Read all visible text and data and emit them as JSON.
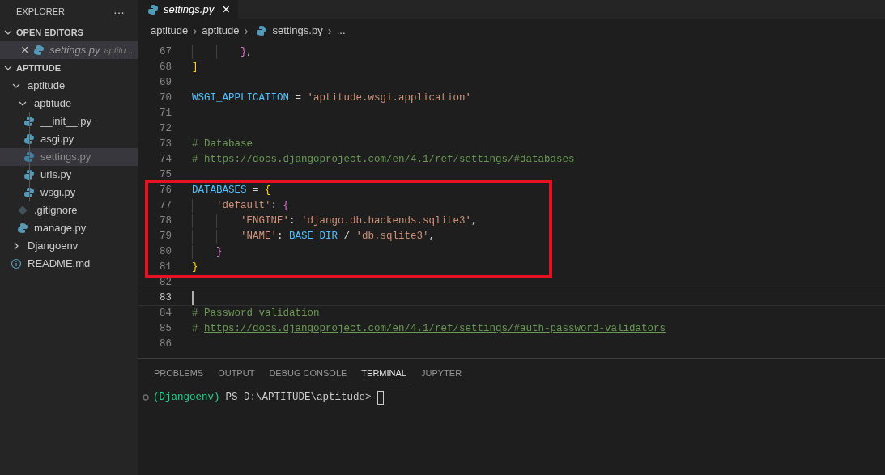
{
  "sidebar": {
    "title": "EXPLORER",
    "more": "···",
    "open_editors": {
      "label": "OPEN EDITORS",
      "expanded": true,
      "items": [
        {
          "close": "×",
          "kind": "python",
          "name": "settings.py",
          "description": "aptitu...",
          "selected": true
        }
      ]
    },
    "folder": {
      "label": "APTITUDE",
      "expanded": true,
      "tree": [
        {
          "kind": "folder",
          "name": "aptitude",
          "expanded": true,
          "selected": false,
          "children": [
            {
              "kind": "folder",
              "name": "aptitude",
              "expanded": true,
              "selected": false,
              "children": [
                {
                  "kind": "python",
                  "name": "__init__.py",
                  "selected": false
                },
                {
                  "kind": "python",
                  "name": "asgi.py",
                  "selected": false
                },
                {
                  "kind": "python",
                  "name": "settings.py",
                  "selected": true
                },
                {
                  "kind": "python",
                  "name": "urls.py",
                  "selected": false
                },
                {
                  "kind": "python",
                  "name": "wsgi.py",
                  "selected": false
                }
              ]
            },
            {
              "kind": "git",
              "name": ".gitignore",
              "selected": false
            },
            {
              "kind": "python",
              "name": "manage.py",
              "selected": false
            }
          ]
        },
        {
          "kind": "folder",
          "name": "Djangoenv",
          "expanded": false,
          "selected": false
        },
        {
          "kind": "info",
          "name": "README.md",
          "selected": false
        }
      ]
    }
  },
  "tabs": [
    {
      "label": "settings.py",
      "kind": "python",
      "preview": true,
      "selected": true,
      "close": "×"
    }
  ],
  "breadcrumbs": [
    {
      "label": "aptitude"
    },
    {
      "label": "aptitude"
    },
    {
      "label": "settings.py",
      "kind": "python"
    },
    {
      "label": "..."
    }
  ],
  "breadcrumb_separator": "›",
  "editor": {
    "lines": [
      {
        "number": "67",
        "current": false,
        "highlighted": false,
        "tokens": [
          {
            "kind": "b2",
            "text": "        }"
          },
          {
            "kind": "plain",
            "text": ","
          }
        ]
      },
      {
        "number": "68",
        "current": false,
        "highlighted": false,
        "tokens": [
          {
            "kind": "b1",
            "text": "]"
          }
        ]
      },
      {
        "number": "69",
        "current": false,
        "highlighted": false
      },
      {
        "number": "70",
        "current": false,
        "highlighted": false,
        "tokens": [
          {
            "kind": "var",
            "text": "WSGI_APPLICATION"
          },
          {
            "kind": "plain",
            "text": " = "
          },
          {
            "kind": "str",
            "text": "'aptitude.wsgi.application'"
          }
        ]
      },
      {
        "number": "71",
        "current": false,
        "highlighted": false
      },
      {
        "number": "72",
        "current": false,
        "highlighted": false
      },
      {
        "number": "73",
        "current": false,
        "highlighted": false,
        "tokens": [
          {
            "kind": "comment",
            "text": "# Database"
          }
        ]
      },
      {
        "number": "74",
        "current": false,
        "highlighted": false,
        "tokens": [
          {
            "kind": "comment",
            "text": "# "
          },
          {
            "kind": "link",
            "text": "https://docs.djangoproject.com/en/4.1/ref/settings/#databases"
          }
        ]
      },
      {
        "number": "75",
        "current": false,
        "highlighted": false
      },
      {
        "number": "76",
        "current": false,
        "highlighted": true,
        "tokens": [
          {
            "kind": "var",
            "text": "DATABASES"
          },
          {
            "kind": "plain",
            "text": " = "
          },
          {
            "kind": "b1",
            "text": "{"
          }
        ]
      },
      {
        "number": "77",
        "current": false,
        "highlighted": true,
        "tokens": [
          {
            "kind": "str",
            "text": "    'default'"
          },
          {
            "kind": "plain",
            "text": ": "
          },
          {
            "kind": "b2",
            "text": "{"
          }
        ]
      },
      {
        "number": "78",
        "current": false,
        "highlighted": true,
        "tokens": [
          {
            "kind": "str",
            "text": "        'ENGINE'"
          },
          {
            "kind": "plain",
            "text": ": "
          },
          {
            "kind": "str",
            "text": "'django.db.backends.sqlite3'"
          },
          {
            "kind": "plain",
            "text": ","
          }
        ]
      },
      {
        "number": "79",
        "current": false,
        "highlighted": true,
        "tokens": [
          {
            "kind": "str",
            "text": "        'NAME'"
          },
          {
            "kind": "plain",
            "text": ": "
          },
          {
            "kind": "var",
            "text": "BASE_DIR"
          },
          {
            "kind": "plain",
            "text": " / "
          },
          {
            "kind": "str",
            "text": "'db.sqlite3'"
          },
          {
            "kind": "plain",
            "text": ","
          }
        ]
      },
      {
        "number": "80",
        "current": false,
        "highlighted": true,
        "tokens": [
          {
            "kind": "b2",
            "text": "    }"
          }
        ]
      },
      {
        "number": "81",
        "current": false,
        "highlighted": true,
        "tokens": [
          {
            "kind": "b1",
            "text": "}"
          }
        ]
      },
      {
        "number": "82",
        "current": false,
        "highlighted": false
      },
      {
        "number": "83",
        "current": true,
        "highlighted": false
      },
      {
        "number": "84",
        "current": false,
        "highlighted": false,
        "tokens": [
          {
            "kind": "comment",
            "text": "# Password validation"
          }
        ]
      },
      {
        "number": "85",
        "current": false,
        "highlighted": false,
        "tokens": [
          {
            "kind": "comment",
            "text": "# "
          },
          {
            "kind": "link",
            "text": "https://docs.djangoproject.com/en/4.1/ref/settings/#auth-password-validators"
          }
        ]
      },
      {
        "number": "86",
        "current": false,
        "highlighted": false
      }
    ]
  },
  "panel": {
    "tabs": [
      {
        "label": "PROBLEMS",
        "selected": false
      },
      {
        "label": "OUTPUT",
        "selected": false
      },
      {
        "label": "DEBUG CONSOLE",
        "selected": false
      },
      {
        "label": "TERMINAL",
        "selected": true
      },
      {
        "label": "JUPYTER",
        "selected": false
      }
    ],
    "terminal": {
      "env": "(Djangoenv)",
      "prompt": "PS D:\\APTITUDE\\aptitude>"
    }
  }
}
